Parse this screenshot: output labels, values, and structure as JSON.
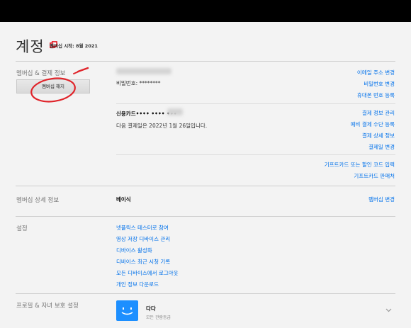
{
  "header": {
    "title": "계정",
    "member_since": "멤버십 시작: 8월 2021"
  },
  "membership": {
    "section_label": "멤버십 & 결제 정보",
    "cancel_button": "멤버십 해지",
    "password": "비밀번호: ********",
    "card": "신용카드•••• •••• •••",
    "next_billing": "다음 결제일은 2022년 1월 26일입니다.",
    "links_top": [
      "이메일 주소 변경",
      "비밀번호 변경",
      "휴대폰 번호 등록"
    ],
    "links_payment": [
      "결제 정보 관리",
      "예비 결제 수단 등록",
      "결제 상세 정보",
      "결제일 변경"
    ],
    "links_gift": [
      "기프트카드 또는 할인 코드 입력",
      "기프트카드 판매처"
    ]
  },
  "plan": {
    "section_label": "멤버십 상세 정보",
    "plan_name": "베이식",
    "change_link": "멤버십 변경"
  },
  "settings": {
    "section_label": "설정",
    "links": [
      "넷플릭스 테스터로 참여",
      "영상 저장 디바이스 관리",
      "디바이스 활성화",
      "디바이스 최근 시청 기록",
      "모든 디바이스에서 로그아웃",
      "개인 정보 다운로드"
    ]
  },
  "profiles": {
    "section_label": "프로필 & 자녀 보호 설정",
    "profile_name": "다다",
    "profile_rating": "모든 관람등급"
  },
  "colors": {
    "link": "#0071eb",
    "accent": "#e50914",
    "avatar": "#1d8fff"
  }
}
